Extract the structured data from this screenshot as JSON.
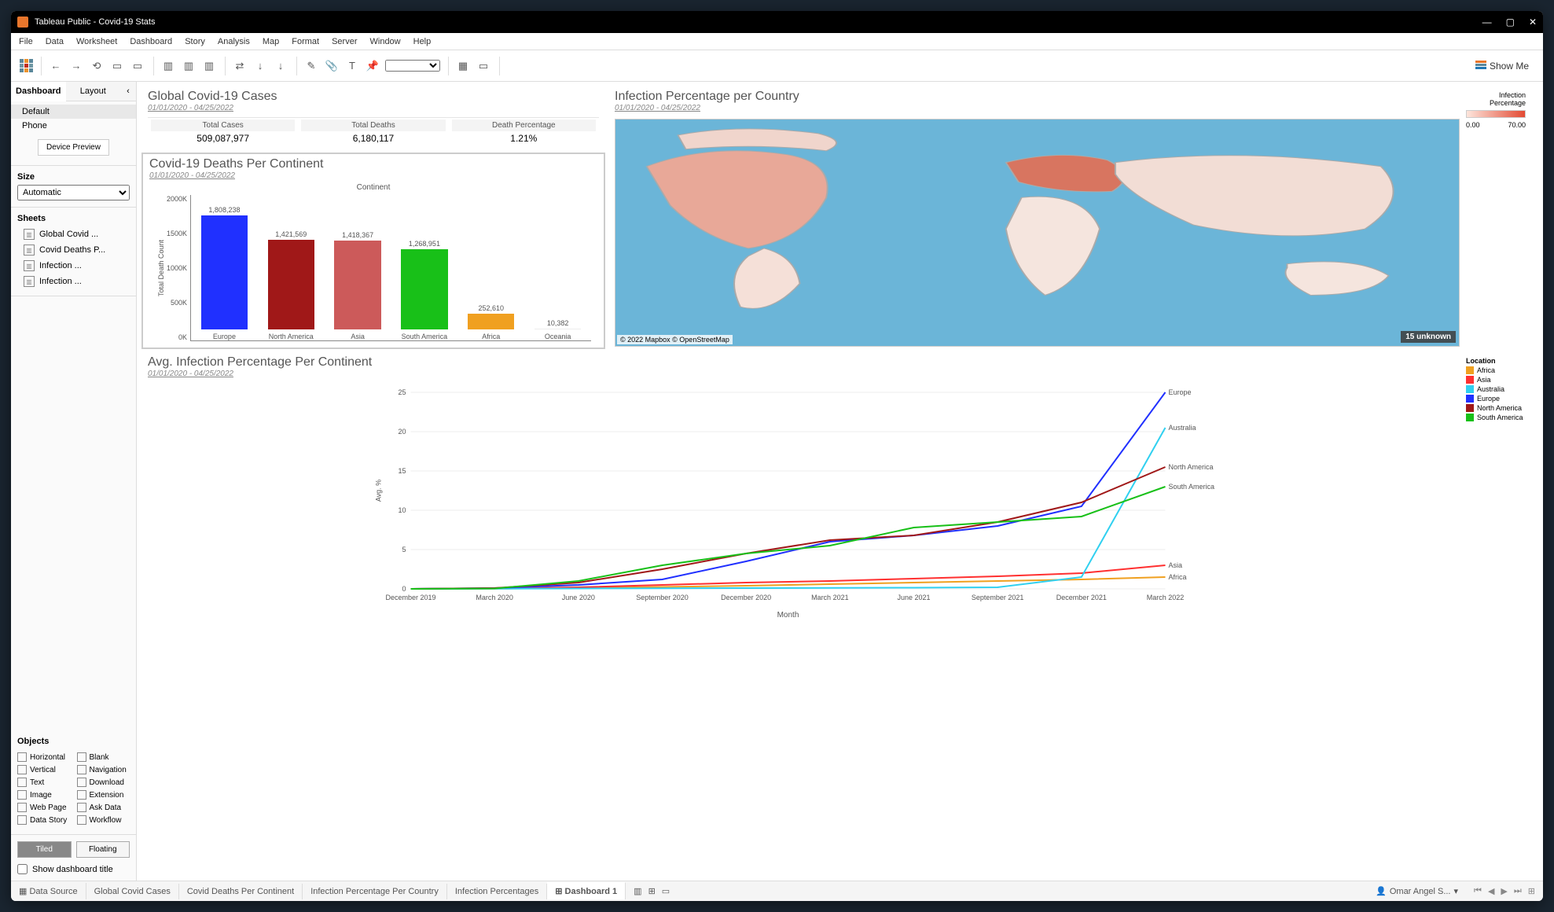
{
  "window": {
    "title": "Tableau Public - Covid-19 Stats"
  },
  "menubar": [
    "File",
    "Data",
    "Worksheet",
    "Dashboard",
    "Story",
    "Analysis",
    "Map",
    "Format",
    "Server",
    "Window",
    "Help"
  ],
  "showme": "Show Me",
  "sidepanel": {
    "tabs": [
      "Dashboard",
      "Layout"
    ],
    "devices": [
      "Default",
      "Phone"
    ],
    "device_preview": "Device Preview",
    "size_label": "Size",
    "size_value": "Automatic",
    "sheets_label": "Sheets",
    "sheets": [
      "Global Covid ...",
      "Covid Deaths P...",
      "Infection ...",
      "Infection ..."
    ],
    "objects_label": "Objects",
    "objects": [
      "Horizontal",
      "Blank",
      "Vertical",
      "Navigation",
      "Text",
      "Download",
      "Image",
      "Extension",
      "Web Page",
      "Ask Data",
      "Data Story",
      "Workflow"
    ],
    "tiled": "Tiled",
    "floating": "Floating",
    "show_title": "Show dashboard title"
  },
  "global": {
    "title": "Global Covid-19 Cases",
    "daterange": "01/01/2020 - 04/25/2022",
    "cols": [
      {
        "hdr": "Total Cases",
        "val": "509,087,977"
      },
      {
        "hdr": "Total Deaths",
        "val": "6,180,117"
      },
      {
        "hdr": "Death Percentage",
        "val": "1.21%"
      }
    ]
  },
  "deaths": {
    "title": "Covid-19 Deaths Per Continent",
    "daterange": "01/01/2020 - 04/25/2022",
    "axistitle": "Continent",
    "ylabel": "Total Death Count",
    "yticks": [
      "2000K",
      "1500K",
      "1000K",
      "500K",
      "0K"
    ]
  },
  "map": {
    "title": "Infection Percentage per Country",
    "daterange": "01/01/2020 - 04/25/2022",
    "legend_title": "Infection Percentage",
    "legend_min": "0.00",
    "legend_max": "70.00",
    "attribution": "© 2022 Mapbox © OpenStreetMap",
    "unknown": "15 unknown"
  },
  "line": {
    "title": "Avg. Infection Percentage Per Continent",
    "daterange": "01/01/2020 - 04/25/2022",
    "ylabel": "Avg. %",
    "xlabel": "Month",
    "legend_title": "Location"
  },
  "chart_data": [
    {
      "type": "bar",
      "title": "Covid-19 Deaths Per Continent",
      "xlabel": "Continent",
      "ylabel": "Total Death Count",
      "ylim": [
        0,
        2000000
      ],
      "categories": [
        "Europe",
        "North America",
        "Asia",
        "South America",
        "Africa",
        "Oceania"
      ],
      "values": [
        1808238,
        1421569,
        1418367,
        1268951,
        252610,
        10382
      ],
      "labels": [
        "1,808,238",
        "1,421,569",
        "1,418,367",
        "1,268,951",
        "252,610",
        "10,382"
      ],
      "colors": [
        "#2030ff",
        "#a01818",
        "#cc5a5a",
        "#18c018",
        "#f0a020",
        "#eeeeee"
      ]
    },
    {
      "type": "line",
      "title": "Avg. Infection Percentage Per Continent",
      "xlabel": "Month",
      "ylabel": "Avg. %",
      "ylim": [
        0,
        25
      ],
      "x": [
        "December 2019",
        "March 2020",
        "June 2020",
        "September 2020",
        "December 2020",
        "March 2021",
        "June 2021",
        "September 2021",
        "December 2021",
        "March 2022"
      ],
      "series": [
        {
          "name": "Africa",
          "color": "#f0a020",
          "values": [
            0,
            0.02,
            0.1,
            0.25,
            0.4,
            0.6,
            0.8,
            1.0,
            1.2,
            1.5
          ]
        },
        {
          "name": "Asia",
          "color": "#ff3030",
          "values": [
            0,
            0.05,
            0.2,
            0.5,
            0.8,
            1.0,
            1.3,
            1.6,
            2.0,
            3.0
          ]
        },
        {
          "name": "Australia",
          "color": "#30d0f0",
          "values": [
            0,
            0.02,
            0.05,
            0.08,
            0.1,
            0.12,
            0.15,
            0.2,
            1.5,
            20.5
          ]
        },
        {
          "name": "Europe",
          "color": "#2030ff",
          "values": [
            0,
            0.1,
            0.5,
            1.2,
            3.5,
            6.0,
            6.8,
            8.0,
            10.5,
            25.0
          ]
        },
        {
          "name": "North America",
          "color": "#a01818",
          "values": [
            0,
            0.1,
            0.8,
            2.5,
            4.5,
            6.2,
            6.8,
            8.5,
            11.0,
            15.5
          ]
        },
        {
          "name": "South America",
          "color": "#18c018",
          "values": [
            0,
            0.05,
            1.0,
            3.0,
            4.5,
            5.5,
            7.8,
            8.5,
            9.2,
            13.0
          ]
        }
      ],
      "end_labels": [
        "Europe",
        "Australia",
        "North America",
        "South America",
        "Asia",
        "Africa"
      ]
    }
  ],
  "bottombar": {
    "datasource": "Data Source",
    "tabs": [
      "Global Covid Cases",
      "Covid Deaths Per Continent",
      "Infection Percentage Per Country",
      "Infection Percentages",
      "Dashboard 1"
    ],
    "user": "Omar Angel S..."
  }
}
